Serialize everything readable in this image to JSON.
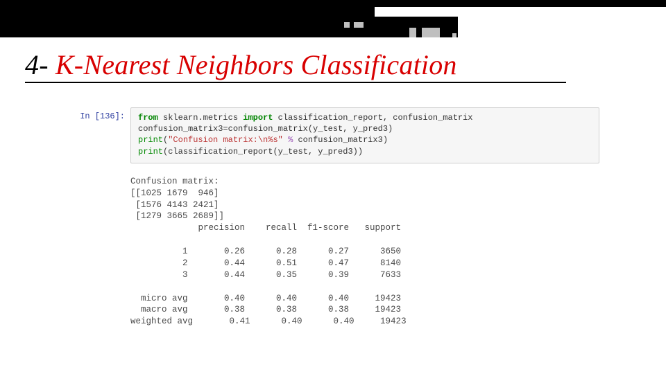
{
  "slide": {
    "title_prefix": "4- ",
    "title_text": "K-Nearest Neighbors Classification"
  },
  "notebook": {
    "prompt": "In [136]:",
    "code": {
      "l1_kw_from": "from",
      "l1_mod": " sklearn.metrics ",
      "l1_kw_import": "import",
      "l1_rest": " classification_report, confusion_matrix",
      "l2": "confusion_matrix3=confusion_matrix(y_test, y_pred3)",
      "l3_fn": "print",
      "l3_open": "(",
      "l3_str": "\"Confusion matrix:\\n%s\"",
      "l3_sp": " ",
      "l3_op": "%",
      "l3_rest": " confusion_matrix3)",
      "l4_fn": "print",
      "l4_rest": "(classification_report(y_test, y_pred3))"
    },
    "output_text": "Confusion matrix:\n[[1025 1679  946]\n [1576 4143 2421]\n [1279 3665 2689]]\n             precision    recall  f1-score   support\n\n          1       0.26      0.28      0.27      3650\n          2       0.44      0.51      0.47      8140\n          3       0.44      0.35      0.39      7633\n\n  micro avg       0.40      0.40      0.40     19423\n  macro avg       0.38      0.38      0.38     19423\nweighted avg       0.41      0.40      0.40     19423"
  },
  "chart_data": {
    "type": "table",
    "title": "KNN classification_report",
    "confusion_matrix": {
      "labels": [
        "1",
        "2",
        "3"
      ],
      "matrix": [
        [
          1025,
          1679,
          946
        ],
        [
          1576,
          4143,
          2421
        ],
        [
          1279,
          3665,
          2689
        ]
      ]
    },
    "report": {
      "columns": [
        "precision",
        "recall",
        "f1-score",
        "support"
      ],
      "rows": [
        {
          "label": "1",
          "precision": 0.26,
          "recall": 0.28,
          "f1": 0.27,
          "support": 3650
        },
        {
          "label": "2",
          "precision": 0.44,
          "recall": 0.51,
          "f1": 0.47,
          "support": 8140
        },
        {
          "label": "3",
          "precision": 0.44,
          "recall": 0.35,
          "f1": 0.39,
          "support": 7633
        },
        {
          "label": "micro avg",
          "precision": 0.4,
          "recall": 0.4,
          "f1": 0.4,
          "support": 19423
        },
        {
          "label": "macro avg",
          "precision": 0.38,
          "recall": 0.38,
          "f1": 0.38,
          "support": 19423
        },
        {
          "label": "weighted avg",
          "precision": 0.41,
          "recall": 0.4,
          "f1": 0.4,
          "support": 19423
        }
      ]
    }
  }
}
